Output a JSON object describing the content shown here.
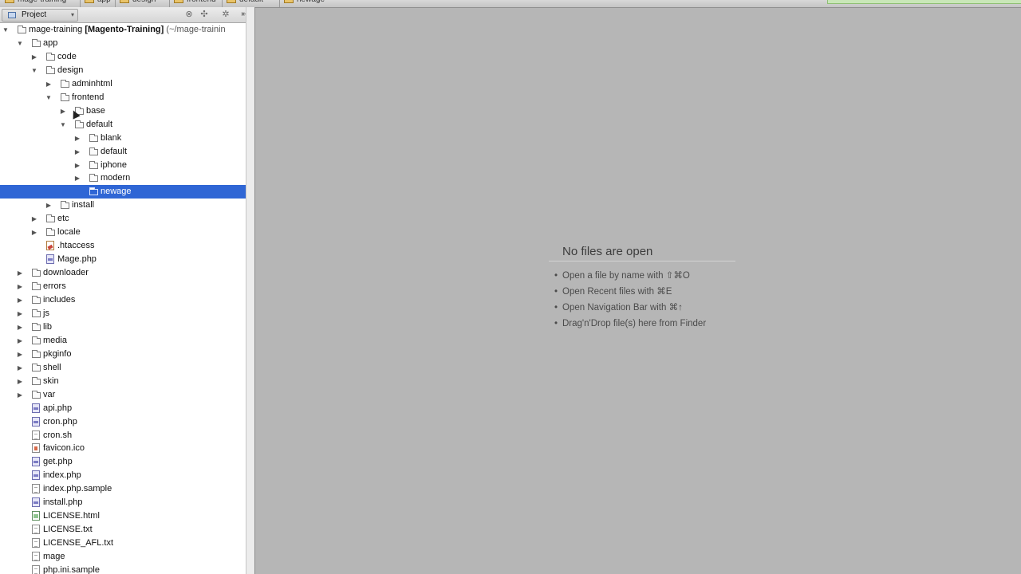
{
  "breadcrumbs": [
    "mage-training",
    "app",
    "design",
    "frontend",
    "default",
    "newage"
  ],
  "project_panel": {
    "view_label": "Project",
    "root": {
      "name": "mage-training",
      "module": "[Magento-Training]",
      "path": "(~/mage-trainin"
    }
  },
  "tree": [
    {
      "label": "app",
      "depth": 1,
      "type": "folder",
      "arrow": "down"
    },
    {
      "label": "code",
      "depth": 2,
      "type": "folder",
      "arrow": "right"
    },
    {
      "label": "design",
      "depth": 2,
      "type": "folder",
      "arrow": "down"
    },
    {
      "label": "adminhtml",
      "depth": 3,
      "type": "folder",
      "arrow": "right"
    },
    {
      "label": "frontend",
      "depth": 3,
      "type": "folder",
      "arrow": "down"
    },
    {
      "label": "base",
      "depth": 4,
      "type": "folder",
      "arrow": "right"
    },
    {
      "label": "default",
      "depth": 4,
      "type": "folder",
      "arrow": "down"
    },
    {
      "label": "blank",
      "depth": 5,
      "type": "folder",
      "arrow": "right"
    },
    {
      "label": "default",
      "depth": 5,
      "type": "folder",
      "arrow": "right"
    },
    {
      "label": "iphone",
      "depth": 5,
      "type": "folder",
      "arrow": "right"
    },
    {
      "label": "modern",
      "depth": 5,
      "type": "folder",
      "arrow": "right"
    },
    {
      "label": "newage",
      "depth": 5,
      "type": "folder",
      "arrow": "none",
      "selected": true
    },
    {
      "label": "install",
      "depth": 3,
      "type": "folder",
      "arrow": "right"
    },
    {
      "label": "etc",
      "depth": 2,
      "type": "folder",
      "arrow": "right"
    },
    {
      "label": "locale",
      "depth": 2,
      "type": "folder",
      "arrow": "right"
    },
    {
      "label": ".htaccess",
      "depth": 2,
      "type": "hta",
      "arrow": "none"
    },
    {
      "label": "Mage.php",
      "depth": 2,
      "type": "php",
      "arrow": "none"
    },
    {
      "label": "downloader",
      "depth": 1,
      "type": "folder",
      "arrow": "right"
    },
    {
      "label": "errors",
      "depth": 1,
      "type": "folder",
      "arrow": "right"
    },
    {
      "label": "includes",
      "depth": 1,
      "type": "folder",
      "arrow": "right"
    },
    {
      "label": "js",
      "depth": 1,
      "type": "folder",
      "arrow": "right"
    },
    {
      "label": "lib",
      "depth": 1,
      "type": "folder",
      "arrow": "right"
    },
    {
      "label": "media",
      "depth": 1,
      "type": "folder",
      "arrow": "right"
    },
    {
      "label": "pkginfo",
      "depth": 1,
      "type": "folder",
      "arrow": "right"
    },
    {
      "label": "shell",
      "depth": 1,
      "type": "folder",
      "arrow": "right"
    },
    {
      "label": "skin",
      "depth": 1,
      "type": "folder",
      "arrow": "right"
    },
    {
      "label": "var",
      "depth": 1,
      "type": "folder",
      "arrow": "right"
    },
    {
      "label": "api.php",
      "depth": 1,
      "type": "php",
      "arrow": "none"
    },
    {
      "label": "cron.php",
      "depth": 1,
      "type": "php",
      "arrow": "none"
    },
    {
      "label": "cron.sh",
      "depth": 1,
      "type": "txt",
      "arrow": "none"
    },
    {
      "label": "favicon.ico",
      "depth": 1,
      "type": "ico",
      "arrow": "none"
    },
    {
      "label": "get.php",
      "depth": 1,
      "type": "php",
      "arrow": "none"
    },
    {
      "label": "index.php",
      "depth": 1,
      "type": "php",
      "arrow": "none"
    },
    {
      "label": "index.php.sample",
      "depth": 1,
      "type": "txt",
      "arrow": "none"
    },
    {
      "label": "install.php",
      "depth": 1,
      "type": "php",
      "arrow": "none"
    },
    {
      "label": "LICENSE.html",
      "depth": 1,
      "type": "html",
      "arrow": "none"
    },
    {
      "label": "LICENSE.txt",
      "depth": 1,
      "type": "txt",
      "arrow": "none"
    },
    {
      "label": "LICENSE_AFL.txt",
      "depth": 1,
      "type": "txt",
      "arrow": "none"
    },
    {
      "label": "mage",
      "depth": 1,
      "type": "txt",
      "arrow": "none"
    },
    {
      "label": "php.ini.sample",
      "depth": 1,
      "type": "txt",
      "arrow": "none"
    }
  ],
  "editor": {
    "empty_title": "No files are open",
    "hints": [
      "Open a file by name with ⇧⌘O",
      "Open Recent files with ⌘E",
      "Open Navigation Bar with ⌘↑",
      "Drag'n'Drop file(s) here from Finder"
    ]
  },
  "colors": {
    "selection": "#2f66d5",
    "editor_bg": "#b6b6b6"
  }
}
